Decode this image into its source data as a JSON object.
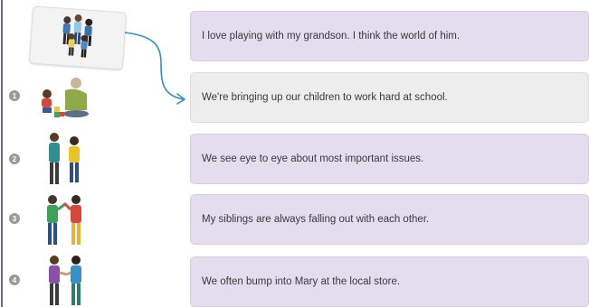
{
  "example": {
    "sentence": "I love playing with my grandson. I think the world of him."
  },
  "items": [
    {
      "number": "1",
      "sentence": "We're bringing up our children to work hard at school."
    },
    {
      "number": "2",
      "sentence": "We see eye to eye about most important issues."
    },
    {
      "number": "3",
      "sentence": "My siblings are always falling out with each other."
    },
    {
      "number": "4",
      "sentence": "We often bump into Mary at the local store."
    }
  ],
  "colors": {
    "box_fill": "#e4dcef",
    "box_fill_active": "#ededed",
    "arrow": "#2f8fc9",
    "badge": "#9a9a9a"
  }
}
